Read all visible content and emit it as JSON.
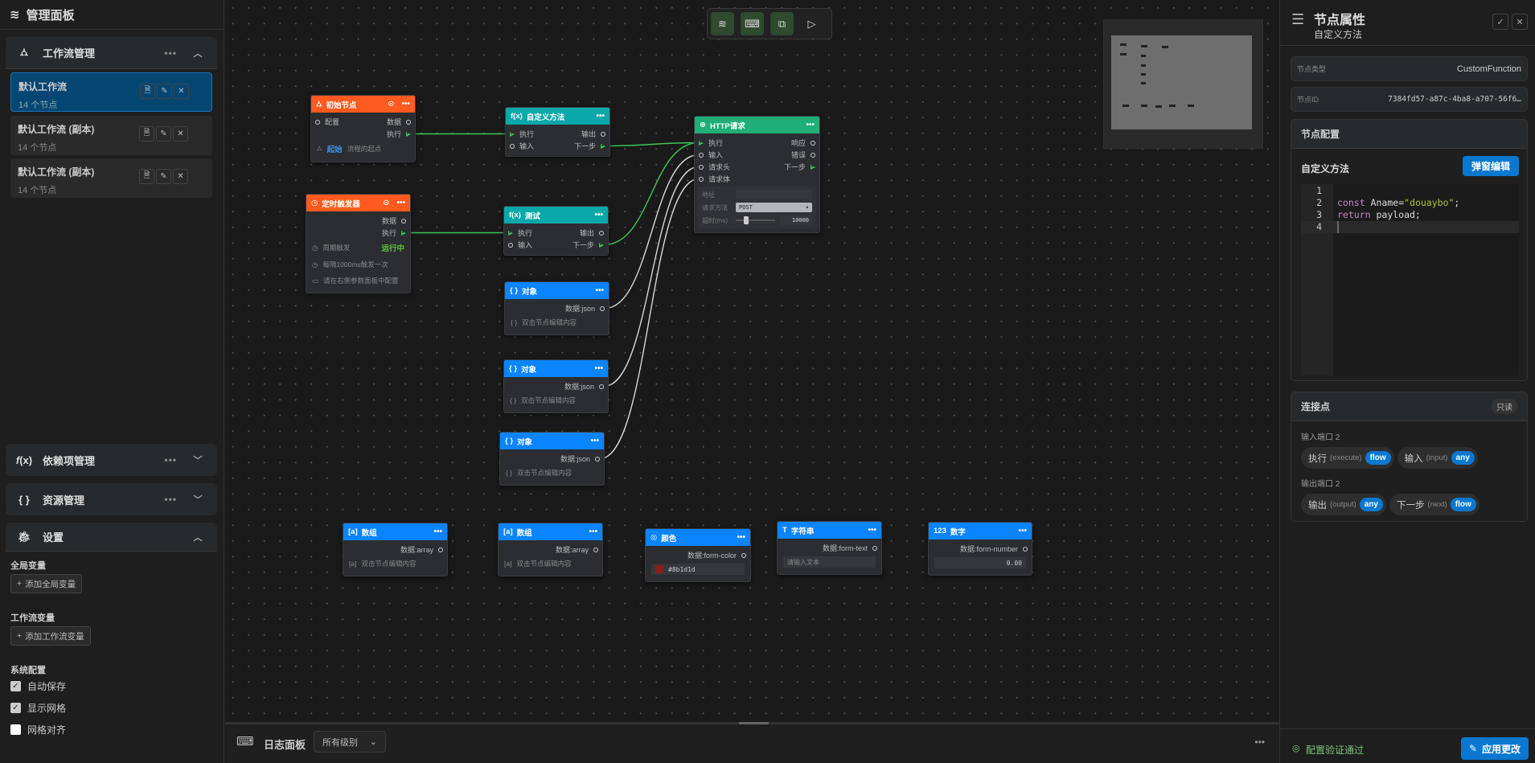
{
  "sidebar": {
    "title": "管理面板",
    "workflow_section": {
      "title": "工作流管理",
      "more": "•••"
    },
    "workflows": [
      {
        "name": "默认工作流",
        "count": "14 个节点",
        "active": true
      },
      {
        "name": "默认工作流 (副本)",
        "count": "14 个节点",
        "active": false
      },
      {
        "name": "默认工作流 (副本)",
        "count": "14 个节点",
        "active": false
      }
    ],
    "dependency_section": {
      "title": "依赖项管理",
      "more": "•••"
    },
    "resource_section": {
      "title": "资源管理",
      "more": "•••"
    },
    "settings_section": {
      "title": "设置"
    },
    "global_vars_label": "全局变量",
    "add_global_var": "添加全局变量",
    "workflow_vars_label": "工作流变量",
    "add_workflow_var": "添加工作流变量",
    "system_config_label": "系统配置",
    "checkboxes": [
      {
        "label": "自动保存",
        "checked": true
      },
      {
        "label": "显示网格",
        "checked": true
      },
      {
        "label": "网格对齐",
        "checked": false
      }
    ]
  },
  "colors": {
    "trigger": "#ff5a1f",
    "function": "#0aa8a8",
    "http": "#1fae78",
    "data": "#0a84ff",
    "flow_edge": "#3cc65a",
    "data_edge": "#d8d8d8",
    "accent": "#0a78d0"
  },
  "nodes": [
    {
      "id": "start",
      "title": "初始节点",
      "kind": "trigger",
      "icon": "⛼",
      "play": true,
      "rows": [
        {
          "in": {
            "label": "配置",
            "type": "data"
          },
          "out": {
            "label": "数据",
            "type": "data"
          }
        },
        {
          "out": {
            "label": "执行",
            "type": "flow"
          }
        }
      ],
      "lines": [
        {
          "icon": "⛼",
          "strong": "起始",
          "text": "流程的起点"
        }
      ]
    },
    {
      "id": "custom",
      "title": "自定义方法",
      "kind": "function",
      "icon": "f(x)",
      "rows": [
        {
          "in": {
            "label": "执行",
            "type": "flow"
          },
          "out": {
            "label": "输出",
            "type": "data"
          }
        },
        {
          "in": {
            "label": "输入",
            "type": "data"
          },
          "out": {
            "label": "下一步",
            "type": "flow"
          }
        }
      ]
    },
    {
      "id": "timer",
      "title": "定时触发器",
      "kind": "trigger",
      "icon": "◷",
      "play": true,
      "rows": [
        {
          "out": {
            "label": "数据",
            "type": "data"
          }
        },
        {
          "out": {
            "label": "执行",
            "type": "flow"
          }
        }
      ],
      "lines": [
        {
          "icon": "◷",
          "text": "周期触发",
          "status": "运行中"
        },
        {
          "icon": "◷",
          "text": "每隔1000ms触发一次"
        },
        {
          "icon": "▭",
          "text": "请在右侧参数面板中配置"
        }
      ]
    },
    {
      "id": "test",
      "title": "测试",
      "kind": "function",
      "icon": "f(x)",
      "rows": [
        {
          "in": {
            "label": "执行",
            "type": "flow"
          },
          "out": {
            "label": "输出",
            "type": "data"
          }
        },
        {
          "in": {
            "label": "输入",
            "type": "data"
          },
          "out": {
            "label": "下一步",
            "type": "flow"
          }
        }
      ]
    },
    {
      "id": "http",
      "title": "HTTP请求",
      "kind": "http",
      "icon": "⊕",
      "rows": [
        {
          "in": {
            "label": "执行",
            "type": "flow"
          },
          "out": {
            "label": "响应",
            "type": "data"
          }
        },
        {
          "in": {
            "label": "输入",
            "type": "data"
          },
          "out": {
            "label": "错误",
            "type": "data"
          }
        },
        {
          "in": {
            "label": "请求头",
            "type": "data"
          },
          "out": {
            "label": "下一步",
            "type": "flow"
          }
        },
        {
          "in": {
            "label": "请求体",
            "type": "data"
          }
        }
      ],
      "fields": [
        {
          "label": "地址",
          "kind": "input",
          "value": ""
        },
        {
          "label": "请求方法",
          "kind": "select",
          "value": "POST"
        },
        {
          "label": "超时(ms)",
          "kind": "slider",
          "value": "10000"
        }
      ]
    },
    {
      "id": "obj1",
      "title": "对象",
      "kind": "data",
      "icon": "{ }",
      "rows": [
        {
          "out": {
            "label": "数据:json",
            "type": "data"
          }
        }
      ],
      "lines": [
        {
          "icon": "{ }",
          "text": "双击节点编辑内容"
        }
      ]
    },
    {
      "id": "obj2",
      "title": "对象",
      "kind": "data",
      "icon": "{ }",
      "rows": [
        {
          "out": {
            "label": "数据:json",
            "type": "data"
          }
        }
      ],
      "lines": [
        {
          "icon": "{ }",
          "text": "双击节点编辑内容"
        }
      ]
    },
    {
      "id": "obj3",
      "title": "对象",
      "kind": "data",
      "icon": "{ }",
      "rows": [
        {
          "out": {
            "label": "数据:json",
            "type": "data"
          }
        }
      ],
      "lines": [
        {
          "icon": "{ }",
          "text": "双击节点编辑内容"
        }
      ]
    },
    {
      "id": "arr1",
      "title": "数组",
      "kind": "data",
      "icon": "[a]",
      "rows": [
        {
          "out": {
            "label": "数据:array",
            "type": "data"
          }
        }
      ],
      "lines": [
        {
          "icon": "[a]",
          "text": "双击节点编辑内容"
        }
      ]
    },
    {
      "id": "arr2",
      "title": "数组",
      "kind": "data",
      "icon": "[a]",
      "rows": [
        {
          "out": {
            "label": "数据:array",
            "type": "data"
          }
        }
      ],
      "lines": [
        {
          "icon": "[a]",
          "text": "双击节点编辑内容"
        }
      ]
    },
    {
      "id": "color",
      "title": "颜色",
      "kind": "data",
      "icon": "◎",
      "rows": [
        {
          "out": {
            "label": "数据:form-color",
            "type": "data"
          }
        }
      ],
      "color_value": "#8b1d1d"
    },
    {
      "id": "string",
      "title": "字符串",
      "kind": "data",
      "icon": "T",
      "rows": [
        {
          "out": {
            "label": "数据:form-text",
            "type": "data"
          }
        }
      ],
      "placeholder": "请输入文本"
    },
    {
      "id": "number",
      "title": "数字",
      "kind": "data",
      "icon": "123",
      "rows": [
        {
          "out": {
            "label": "数据:form-number",
            "type": "data"
          }
        }
      ],
      "number_value": "0.00"
    }
  ],
  "edges": [
    {
      "from": "start",
      "from_port": "执行",
      "to": "custom",
      "to_port": "执行",
      "type": "flow"
    },
    {
      "from": "timer",
      "from_port": "执行",
      "to": "test",
      "to_port": "执行",
      "type": "flow"
    },
    {
      "from": "custom",
      "from_port": "下一步",
      "to": "http",
      "to_port": "执行",
      "type": "flow"
    },
    {
      "from": "test",
      "from_port": "下一步",
      "to": "http",
      "to_port": "执行",
      "type": "flow"
    },
    {
      "from": "obj1",
      "from_port": "数据:json",
      "to": "http",
      "to_port": "输入",
      "type": "data"
    },
    {
      "from": "obj2",
      "from_port": "数据:json",
      "to": "http",
      "to_port": "请求头",
      "type": "data"
    },
    {
      "from": "obj3",
      "from_port": "数据:json",
      "to": "http",
      "to_port": "请求体",
      "type": "data"
    }
  ],
  "log": {
    "title": "日志面板",
    "level": "所有级别",
    "more": "•••"
  },
  "props": {
    "title": "节点属性",
    "subtitle": "自定义方法",
    "type_label": "节点类型",
    "type_value": "CustomFunction",
    "id_label": "节点ID",
    "id_value": "7384fd57-a87c-4ba8-a707-56f6…",
    "config_title": "节点配置",
    "method_label": "自定义方法",
    "popup_edit": "弹窗编辑",
    "code_lines": [
      "",
      "const Aname=\"douaybo\";",
      "return payload;",
      ""
    ],
    "code_tokens": {
      "kw1": "const",
      "var": " Aname=",
      "str": "\"douaybo\"",
      "semi": ";",
      "kw2": "return",
      "rest": " payload;"
    },
    "line_numbers": [
      "1",
      "2",
      "3",
      "4"
    ],
    "ports_title": "连接点",
    "readonly": "只读",
    "inputs_label": "输入端口 2",
    "inputs": [
      {
        "name": "执行",
        "en": "(execute)",
        "type": "flow"
      },
      {
        "name": "输入",
        "en": "(input)",
        "type": "any"
      }
    ],
    "outputs_label": "输出端口 2",
    "outputs": [
      {
        "name": "输出",
        "en": "(output)",
        "type": "any"
      },
      {
        "name": "下一步",
        "en": "(next)",
        "type": "flow"
      }
    ],
    "validation": "配置验证通过",
    "apply": "应用更改"
  }
}
